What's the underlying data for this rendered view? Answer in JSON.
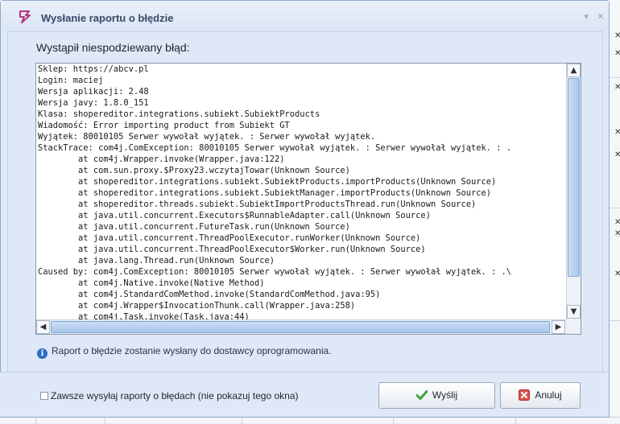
{
  "dialog": {
    "title": "Wysłanie raportu o błędzie",
    "heading": "Wystąpił niespodziewany błąd:",
    "log_lines": [
      "Sklep: https://abcv.pl",
      "Login: maciej",
      "Wersja aplikacji: 2.48",
      "Wersja javy: 1.8.0_151",
      "Klasa: shopereditor.integrations.subiekt.SubiektProducts",
      "Wiadomość: Error importing product from Subiekt GT",
      "Wyjątek: 80010105 Serwer wywołał wyjątek. : Serwer wywołał wyjątek.",
      "StackTrace: com4j.ComException: 80010105 Serwer wywołał wyjątek. : Serwer wywołał wyjątek. : .",
      "\tat com4j.Wrapper.invoke(Wrapper.java:122)",
      "\tat com.sun.proxy.$Proxy23.wczytajTowar(Unknown Source)",
      "\tat shopereditor.integrations.subiekt.SubiektProducts.importProducts(Unknown Source)",
      "\tat shopereditor.integrations.subiekt.SubiektManager.importProducts(Unknown Source)",
      "\tat shopereditor.threads.subiekt.SubiektImportProductsThread.run(Unknown Source)",
      "\tat java.util.concurrent.Executors$RunnableAdapter.call(Unknown Source)",
      "\tat java.util.concurrent.FutureTask.run(Unknown Source)",
      "\tat java.util.concurrent.ThreadPoolExecutor.runWorker(Unknown Source)",
      "\tat java.util.concurrent.ThreadPoolExecutor$Worker.run(Unknown Source)",
      "\tat java.lang.Thread.run(Unknown Source)",
      "Caused by: com4j.ComException: 80010105 Serwer wywołał wyjątek. : Serwer wywołał wyjątek. : .\\",
      "\tat com4j.Native.invoke(Native Method)",
      "\tat com4j.StandardComMethod.invoke(StandardComMethod.java:95)",
      "\tat com4j.Wrapper$InvocationThunk.call(Wrapper.java:258)",
      "\tat com4j.Task.invoke(Task.java:44)"
    ],
    "info_text": "Raport o błędzie zostanie wysłany do dostawcy oprogramowania.",
    "checkbox_label": "Zawsze wysyłaj raporty o błędach (nie pokazuj tego okna)",
    "checkbox_checked": false,
    "send_label": "Wyślij",
    "cancel_label": "Anuluj"
  },
  "icons": {
    "app": "app-logo-icon",
    "minimize": "chevron-down-icon",
    "close": "close-icon",
    "info": "info-icon",
    "send": "checkmark-icon",
    "cancel": "cancel-icon"
  },
  "colors": {
    "accent": "#2d6cc0",
    "send_icon": "#3aa33a",
    "cancel_icon": "#d9534f",
    "app_icon": "#b8327a"
  }
}
